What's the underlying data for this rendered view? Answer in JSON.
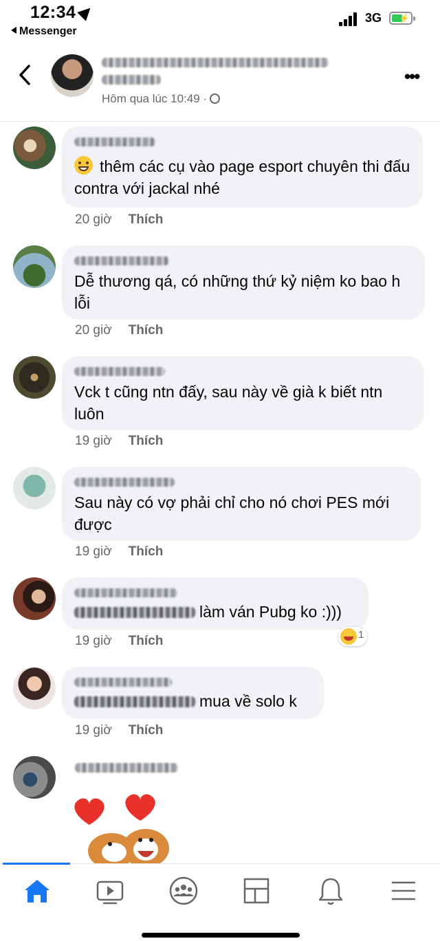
{
  "status_bar": {
    "time": "12:34",
    "back_app": "Messenger",
    "network": "3G"
  },
  "post_header": {
    "timestamp": "Hôm qua lúc 10:49 ·"
  },
  "comments": [
    {
      "text": "thêm các cụ vào page esport chuyên thi đấu contra với jackal nhé",
      "time": "20 giờ",
      "like": "Thích",
      "has_emoji": true
    },
    {
      "text": "Dễ thương qá, có những thứ kỷ niệm ko bao h lỗi",
      "time": "20 giờ",
      "like": "Thích"
    },
    {
      "text": "Vck t cũng ntn đấy, sau này về già k biết ntn luôn",
      "time": "19 giờ",
      "like": "Thích"
    },
    {
      "text": "Sau này có vợ phải chỉ cho nó chơi PES mới được",
      "time": "19 giờ",
      "like": "Thích"
    },
    {
      "text": "làm ván Pubg ko :)))",
      "time": "19 giờ",
      "like": "Thích",
      "reaction": {
        "icon": "laugh-reaction-icon",
        "count": "1"
      }
    },
    {
      "text": "mua về solo k",
      "time": "19 giờ",
      "like": "Thích"
    }
  ],
  "last_comment": {
    "sticker": "hearts-dogs-sticker"
  },
  "nav": {
    "items": [
      "home-icon",
      "watch-icon",
      "groups-icon",
      "pages-icon",
      "notifications-icon",
      "menu-icon"
    ],
    "accent": "#1877f2"
  }
}
